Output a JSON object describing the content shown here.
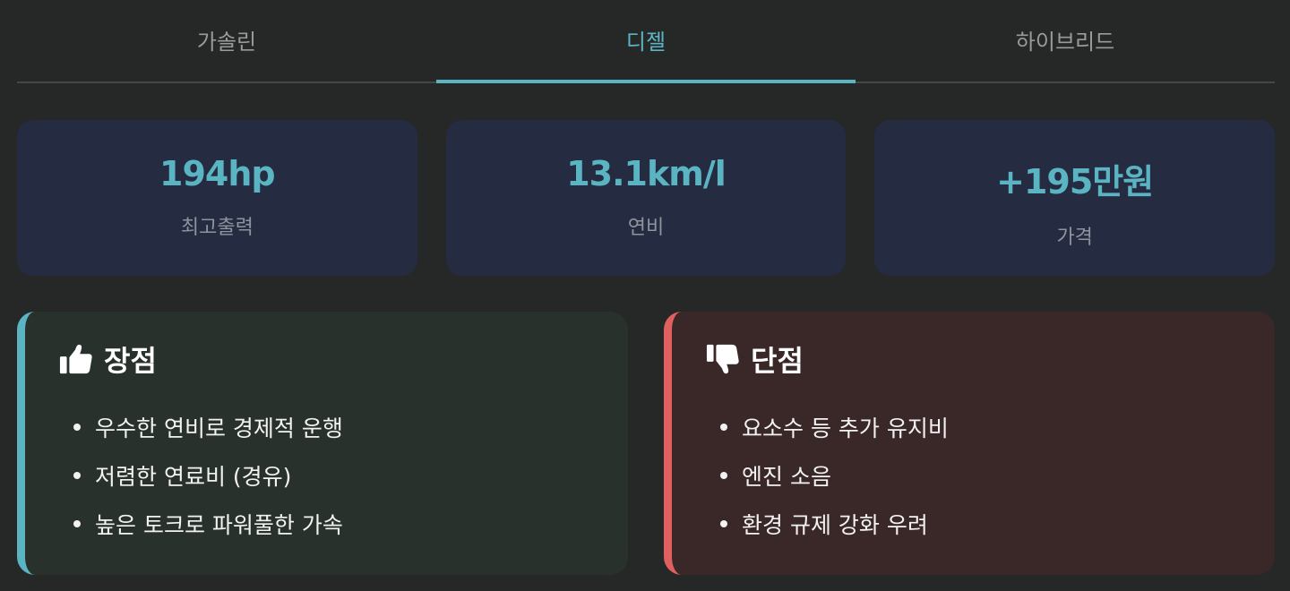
{
  "tabs": [
    {
      "label": "가솔린",
      "active": false
    },
    {
      "label": "디젤",
      "active": true
    },
    {
      "label": "하이브리드",
      "active": false
    }
  ],
  "stats": [
    {
      "value": "194hp",
      "label": "최고출력"
    },
    {
      "value": "13.1km/l",
      "label": "연비"
    },
    {
      "value": "+195만원",
      "label": "가격"
    }
  ],
  "pros": {
    "icon": "thumbs-up-icon",
    "title": "장점",
    "items": [
      "우수한 연비로 경제적 운행",
      "저렴한 연료비 (경유)",
      "높은 토크로 파워풀한 가속"
    ]
  },
  "cons": {
    "icon": "thumbs-down-icon",
    "title": "단점",
    "items": [
      "요소수 등 추가 유지비",
      "엔진 소음",
      "환경 규제 강화 우려"
    ]
  },
  "colors": {
    "accent": "#5ab4c2",
    "pros_border": "#5ab4c2",
    "cons_border": "#e0605f",
    "stat_card": "#252c42",
    "background": "#262727"
  }
}
